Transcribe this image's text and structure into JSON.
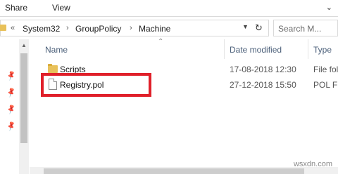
{
  "ribbon": {
    "tabs": [
      "Share",
      "View"
    ],
    "expand_icon": "chevron-down-icon"
  },
  "address_bar": {
    "overflow": "«",
    "crumbs": [
      "System32",
      "GroupPolicy",
      "Machine"
    ],
    "separator": "›",
    "dropdown_icon": "chevron-down-icon",
    "refresh_icon": "refresh-icon"
  },
  "search": {
    "placeholder": "Search M..."
  },
  "columns": {
    "name": "Name",
    "date_modified": "Date modified",
    "type": "Type"
  },
  "files": [
    {
      "name": "Scripts",
      "date": "17-08-2018 12:30",
      "type": "File fol",
      "icon": "folder-icon"
    },
    {
      "name": "Registry.pol",
      "date": "27-12-2018 15:50",
      "type": "POL File",
      "icon": "document-icon"
    }
  ],
  "highlight": {
    "target": "Registry.pol",
    "color": "#e0202a"
  },
  "watermark": {
    "text": "wsxdn.com"
  }
}
